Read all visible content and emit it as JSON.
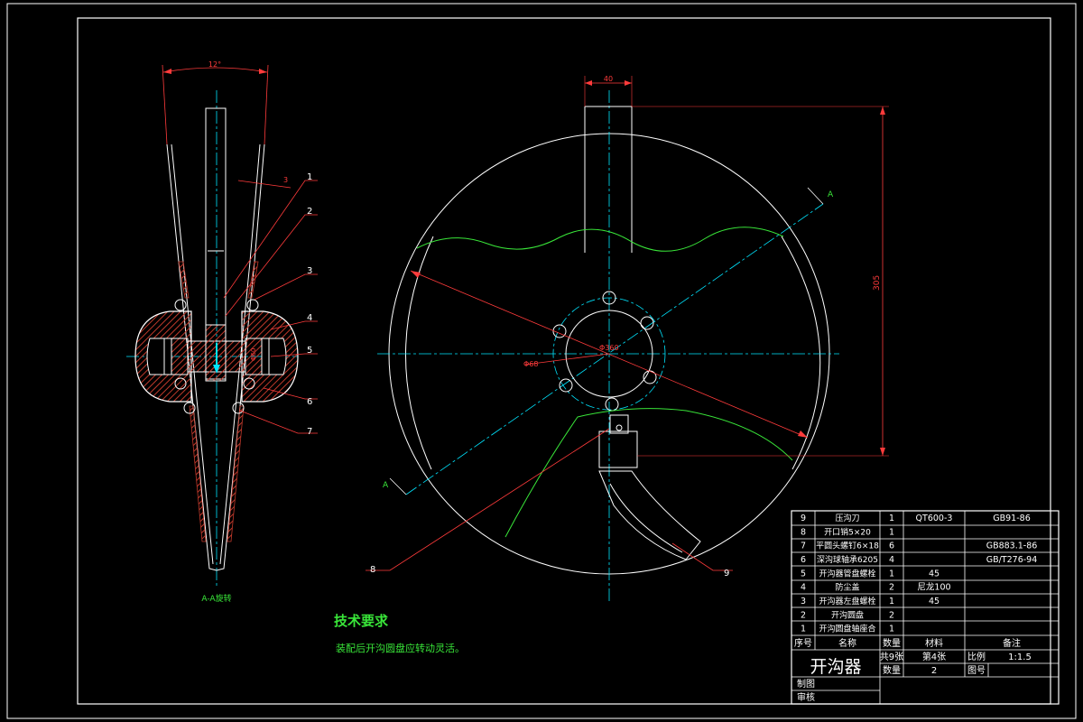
{
  "drawing": {
    "section_label": "A-A旋转",
    "dims": {
      "angle": "12°",
      "thickness": "3",
      "hub_width": "40",
      "height": "305",
      "outer_dia": "Φ360",
      "inner_dia": "Φ68",
      "section_mark": "A",
      "hub_dia": "Φ60"
    },
    "callouts": [
      "1",
      "2",
      "3",
      "4",
      "5",
      "6",
      "7",
      "8",
      "9"
    ]
  },
  "notes": {
    "title": "技术要求",
    "line1": "装配后开沟圆盘应转动灵活。"
  },
  "bom": {
    "rows": [
      {
        "no": "9",
        "name": "压沟刀",
        "qty": "1",
        "material": "QT600-3",
        "remark": "GB91-86"
      },
      {
        "no": "8",
        "name": "开口销5×20",
        "qty": "1",
        "material": "",
        "remark": ""
      },
      {
        "no": "7",
        "name": "平圆头螺钉6×18",
        "qty": "6",
        "material": "",
        "remark": "GB883.1-86"
      },
      {
        "no": "6",
        "name": "深沟球轴承6205",
        "qty": "4",
        "material": "",
        "remark": "GB/T276-94"
      },
      {
        "no": "5",
        "name": "开沟器管盘螺栓",
        "qty": "1",
        "material": "45",
        "remark": ""
      },
      {
        "no": "4",
        "name": "防尘盖",
        "qty": "2",
        "material": "尼龙100",
        "remark": ""
      },
      {
        "no": "3",
        "name": "开沟器左盘螺栓",
        "qty": "1",
        "material": "45",
        "remark": ""
      },
      {
        "no": "2",
        "name": "开沟圆盘",
        "qty": "2",
        "material": "",
        "remark": ""
      },
      {
        "no": "1",
        "name": "开沟圆盘轴座合",
        "qty": "1",
        "material": "",
        "remark": ""
      }
    ],
    "header": {
      "no": "序号",
      "name": "名称",
      "qty": "数量",
      "material": "材料",
      "remark": "备注"
    }
  },
  "titleblock": {
    "name": "开沟器",
    "sheets": "共9张",
    "sheet_no": "第4张",
    "scale_label": "比例",
    "scale": "1:1.5",
    "qty_label": "数量",
    "qty": "2",
    "drawing_no_label": "图号",
    "drawn_label": "制图",
    "checked_label": "审核"
  },
  "colors": {
    "background": "#000000",
    "frame": "#ffffff",
    "dimension": "#ff3b3b",
    "centerline": "#00e5ff",
    "hatch": "#c0392b",
    "soil_line": "#39e639",
    "note_text": "#39e639"
  }
}
